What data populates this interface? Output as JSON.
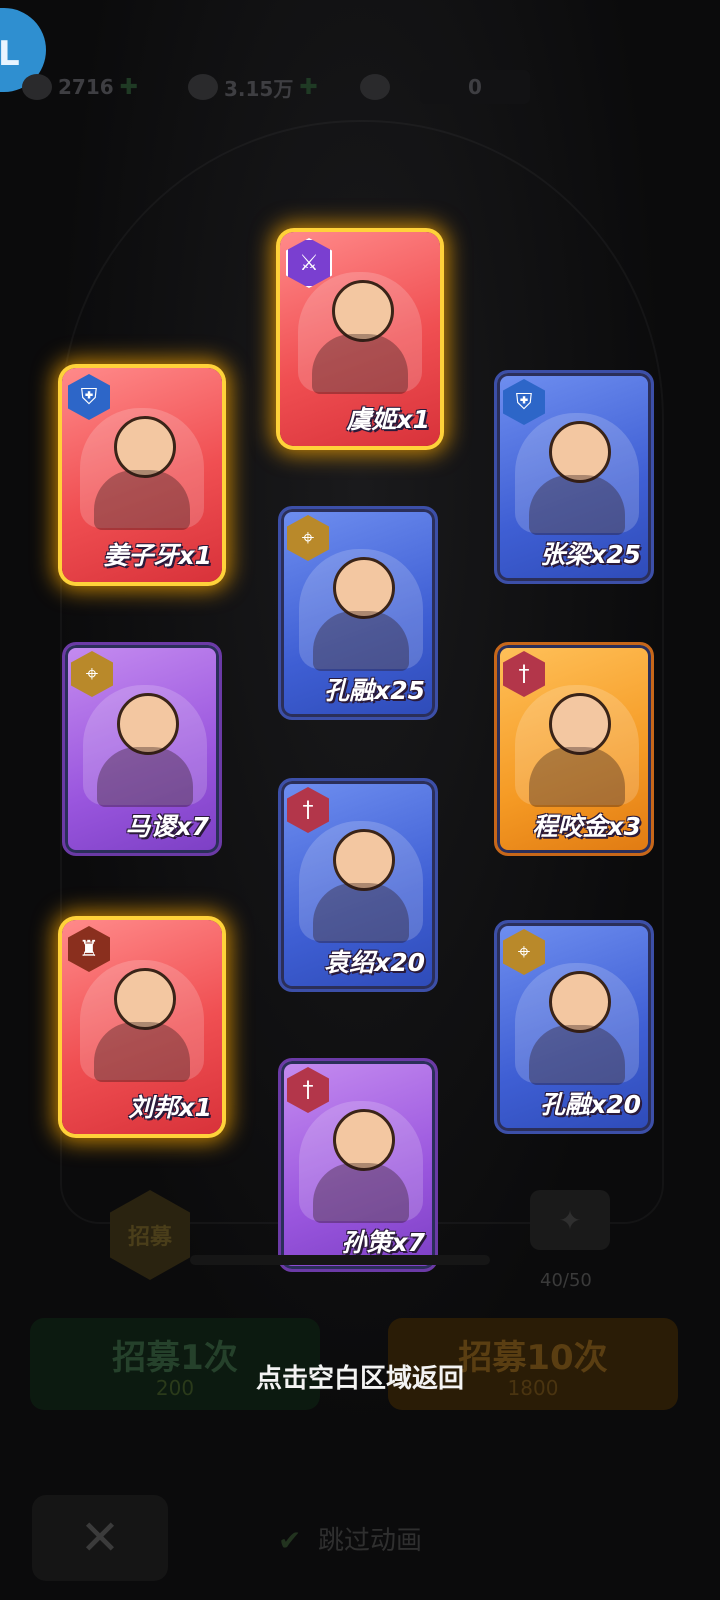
{
  "top_bar": {
    "logo_text": "L",
    "resource_1": "2716",
    "resource_2": "3.15万",
    "resource_3": "0"
  },
  "cards": [
    {
      "id": "c1",
      "name": "姜子牙x1",
      "rarity": "red",
      "badge_icon": "shield-icon",
      "glow": true
    },
    {
      "id": "c2",
      "name": "虞姬x1",
      "rarity": "red",
      "badge_icon": "crossed-swords-icon",
      "glow": true
    },
    {
      "id": "c3",
      "name": "张梁x25",
      "rarity": "blue",
      "badge_icon": "shield-icon",
      "glow": false
    },
    {
      "id": "c4",
      "name": "孔融x25",
      "rarity": "blue",
      "badge_icon": "crossbow-icon",
      "glow": false
    },
    {
      "id": "c5",
      "name": "马谡x7",
      "rarity": "purple",
      "badge_icon": "crossbow-icon",
      "glow": false
    },
    {
      "id": "c6",
      "name": "程咬金x3",
      "rarity": "orange",
      "badge_icon": "sword-icon",
      "glow": false
    },
    {
      "id": "c7",
      "name": "袁绍x20",
      "rarity": "blue",
      "badge_icon": "sword-icon",
      "glow": false
    },
    {
      "id": "c8",
      "name": "刘邦x1",
      "rarity": "red",
      "badge_icon": "hat-icon",
      "glow": true
    },
    {
      "id": "c9",
      "name": "孔融x20",
      "rarity": "blue",
      "badge_icon": "crossbow-icon",
      "glow": false
    },
    {
      "id": "c10",
      "name": "孙策x7",
      "rarity": "purple",
      "badge_icon": "sword-icon",
      "glow": false
    }
  ],
  "hud": {
    "recruit_label": "招募",
    "progress_text": "40/50",
    "btn_recruit_1": "招募1次",
    "btn_recruit_1_cost": "200",
    "btn_recruit_10": "招募10次",
    "btn_recruit_10_cost": "1800",
    "skip_label": "跳过动画",
    "close_symbol": "✕"
  },
  "back_hint": "点击空白区域返回",
  "colors": {
    "glow": "#ffd23a",
    "red_card": "#f04f52",
    "blue_card": "#3f5fd4",
    "purple_card": "#9a56de",
    "orange_card": "#f59a24"
  }
}
